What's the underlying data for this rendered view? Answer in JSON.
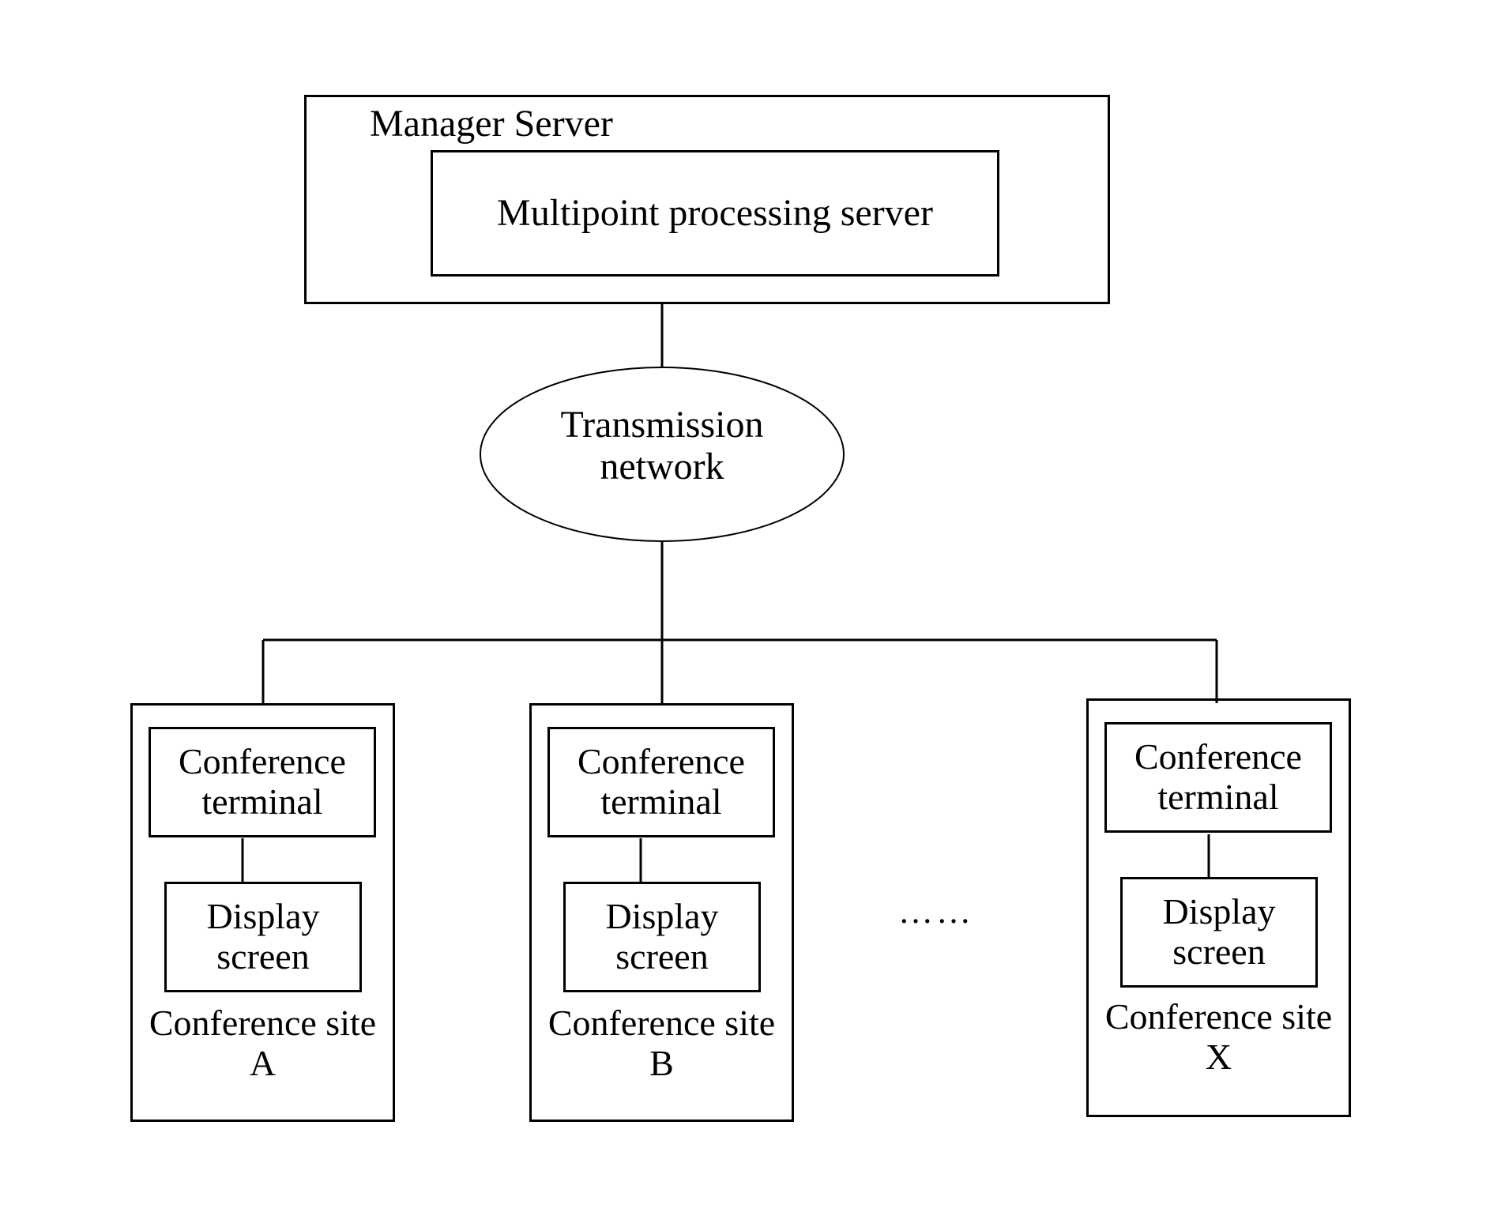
{
  "manager": {
    "title": "Manager Server",
    "inner": "Multipoint processing server"
  },
  "network": {
    "label": "Transmission network"
  },
  "sites": [
    {
      "terminal": "Conference terminal",
      "display": "Display screen",
      "site": "Conference site A"
    },
    {
      "terminal": "Conference terminal",
      "display": "Display screen",
      "site": "Conference site B"
    },
    {
      "terminal": "Conference terminal",
      "display": "Display screen",
      "site": "Conference site X"
    }
  ],
  "ellipsis": "……"
}
